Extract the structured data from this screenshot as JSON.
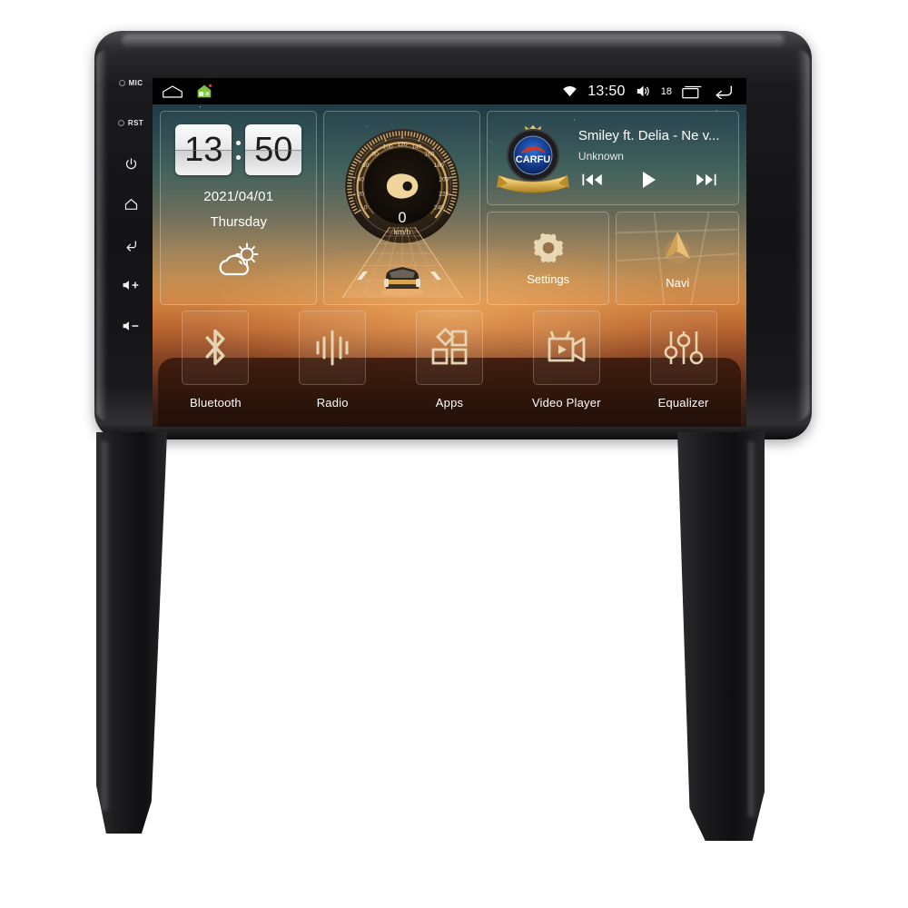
{
  "device": {
    "name": "Android Car Head Unit",
    "side_buttons": [
      {
        "id": "mic",
        "label": "MIC",
        "icon": "led-dot-icon"
      },
      {
        "id": "rst",
        "label": "RST",
        "icon": "led-dot-icon"
      },
      {
        "id": "power",
        "label": "",
        "icon": "power-icon",
        "glyph": "⏻"
      },
      {
        "id": "home",
        "label": "",
        "icon": "home-icon",
        "glyph": "⌂"
      },
      {
        "id": "back",
        "label": "",
        "icon": "back-arrow-icon",
        "glyph": "↩"
      },
      {
        "id": "vol-up",
        "label": "",
        "icon": "volume-up-icon",
        "glyph": "◁+"
      },
      {
        "id": "vol-down",
        "label": "",
        "icon": "volume-down-icon",
        "glyph": "◁-"
      }
    ]
  },
  "status_bar": {
    "left_icons": [
      {
        "name": "navbar-home-outline-icon"
      },
      {
        "name": "green-house-icon"
      }
    ],
    "wifi_icon": "wifi-icon",
    "time": "13:50",
    "volume_icon": "volume-icon",
    "volume_level": "18",
    "recents_icon": "recents-icon",
    "back_icon": "back-icon"
  },
  "clock_widget": {
    "hours": "13",
    "minutes": "50",
    "date": "2021/04/01",
    "weekday": "Thursday",
    "weather_icon": "partly-cloudy-icon"
  },
  "speedometer_widget": {
    "value": "0",
    "unit": "km/h",
    "ticks": [
      "0",
      "20",
      "40",
      "60",
      "80",
      "100",
      "120",
      "140",
      "160",
      "180",
      "200",
      "220",
      "240"
    ],
    "needle_icon": "speed-needle-icon",
    "car_icon": "car-on-road-icon"
  },
  "music_widget": {
    "album_art": "carfu-badge-logo",
    "album_art_text": "CARFU",
    "title": "Smiley ft. Delia - Ne v...",
    "artist": "Unknown",
    "controls": [
      {
        "name": "previous-track-button",
        "icon": "skip-back-icon"
      },
      {
        "name": "play-button",
        "icon": "play-icon"
      },
      {
        "name": "next-track-button",
        "icon": "skip-forward-icon"
      }
    ]
  },
  "tiles": [
    {
      "label": "Settings",
      "icon": "gear-icon",
      "name": "tile-settings"
    },
    {
      "label": "Navi",
      "icon": "navigation-arrow-icon",
      "name": "tile-navi"
    }
  ],
  "dock": [
    {
      "label": "Bluetooth",
      "icon": "bluetooth-icon",
      "name": "dock-item-bluetooth"
    },
    {
      "label": "Radio",
      "icon": "radio-waveform-icon",
      "name": "dock-item-radio"
    },
    {
      "label": "Apps",
      "icon": "apps-grid-icon",
      "name": "dock-item-apps"
    },
    {
      "label": "Video Player",
      "icon": "video-camera-icon",
      "name": "dock-item-video-player"
    },
    {
      "label": "Equalizer",
      "icon": "equalizer-sliders-icon",
      "name": "dock-item-equalizer"
    }
  ],
  "colors": {
    "accent_gold": "#d8bd8c",
    "panel_border": "rgba(255,255,255,0.28)",
    "status_bar_bg": "#000000",
    "sky_top": "#1c2f38",
    "sunset": "#d0833f"
  }
}
